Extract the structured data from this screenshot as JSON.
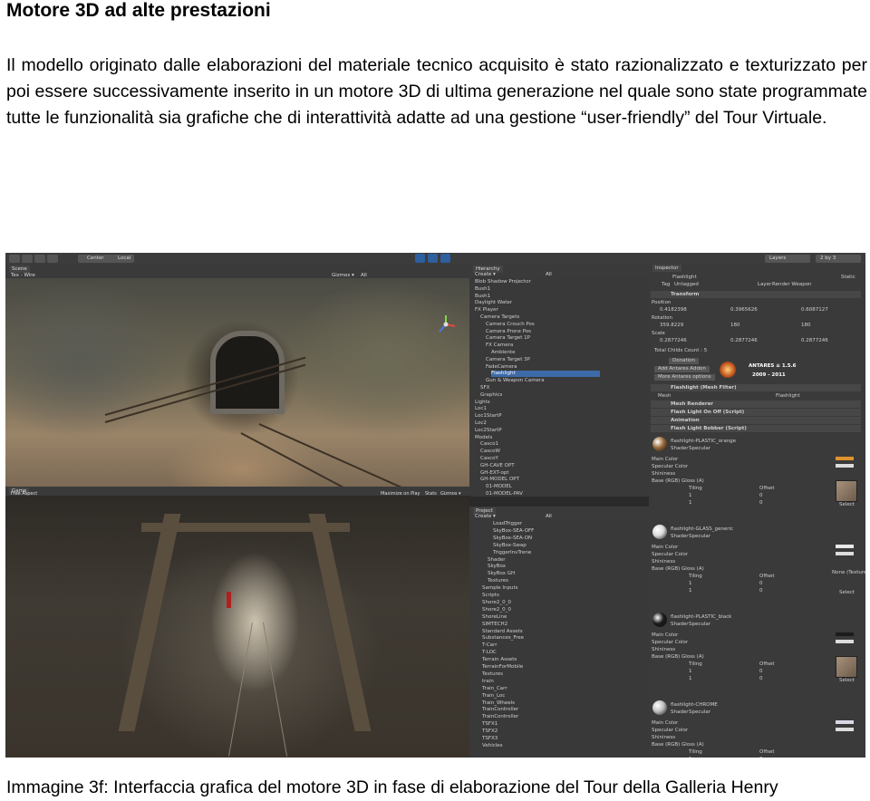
{
  "page": {
    "title": "Motore 3D ad alte prestazioni",
    "paragraph": "Il modello originato dalle elaborazioni del materiale tecnico acquisito è stato razionalizzato e texturizzato per poi essere successivamente inserito in un motore 3D di ultima generazione nel quale sono state programmate tutte le funzionalità sia grafiche che di interattività adatte ad una gestione “user-friendly” del Tour Virtuale.",
    "caption": "Immagine 3f: Interfaccia grafica del motore 3D in fase di elaborazione del Tour della Galleria Henry"
  },
  "editor": {
    "toolbar": {
      "center": "Center",
      "local": "Local",
      "layers": "Layers",
      "layout": "2 by 3"
    },
    "scene_tab": {
      "label": "Scene",
      "mode": "Tex - Wire",
      "gizmos": "Gizmos ▾",
      "all": "All"
    },
    "game_tab": {
      "label": "Game",
      "aspect": "Free Aspect",
      "maximize": "Maximize on Play",
      "stats": "Stats",
      "gizmos": "Gizmos ▾"
    },
    "hierarchy": {
      "label": "Hierarchy",
      "create": "Create ▾",
      "all": "All",
      "items": [
        "Blob Shadow Projector",
        "Bush1",
        "Bush1",
        "Daylight Water",
        "FX Player",
        "Camera Targets",
        "Camera Crouch Pos",
        "Camera Prone Pos",
        "Camera Target 1P",
        "FX Camera",
        "Ambiente",
        "Camera Target 3P",
        "FadeCamera",
        "Flashlight",
        "Gun & Weapon Camera",
        "SFX",
        "Graphics",
        "Lights",
        "Loc1",
        "Loc1StartP",
        "Loc2",
        "Loc2StartP",
        "Models",
        "Casco1",
        "CascoW",
        "CascoY",
        "GH-CAVE OPT",
        "GH-EXT-opt",
        "GH-MODEL OPT",
        "01-MODEL",
        "01-MODEL-PAV"
      ],
      "selected_index": 13
    },
    "project": {
      "label": "Project",
      "create": "Create ▾",
      "all": "All",
      "items": [
        "LoadTrigger",
        "SkyBox-SEA-OFF",
        "SkyBox-SEA-ON",
        "SkyBox-Swap",
        "TriggerInvTrene",
        "Shader",
        "SkyBox",
        "SkyBox GH",
        "Textures",
        "Sample Inputs",
        "Scripts",
        "Shore2_0_0",
        "Shore2_0_0",
        "ShoreLine",
        "SIMTECH2",
        "Standard Assets",
        "Substances_Free",
        "T-Carr",
        "T-LOC",
        "Terrain Assets",
        "TerrainForMobile",
        "Textures",
        "train",
        "Train_Carr",
        "Train_Loc",
        "Train_Wheels",
        "TrainController",
        "TrainController",
        "TSFX1",
        "TSFX2",
        "TSFX3",
        "Vehicles"
      ]
    },
    "inspector": {
      "label": "Inspector",
      "object_name": "Flashlight",
      "static": "Static",
      "tag_label": "Tag",
      "tag": "Untagged",
      "layer_label": "Layer",
      "layer": "Render Weapon",
      "transform": "Transform",
      "position_label": "Position",
      "position": {
        "x": "0.4182398",
        "y": "0.3965626",
        "z": "0.6087127"
      },
      "rotation_label": "Rotation",
      "rotation": {
        "x": "359.8229",
        "y": "180",
        "z": "180"
      },
      "scale_label": "Scale",
      "scale": {
        "x": "0.2877246",
        "y": "0.2877246",
        "z": "0.2877246"
      },
      "child_count": "Total Childs Count : 5",
      "donation": "Donation",
      "add_antares": "Add Antares Addon",
      "more_antares": "More Antares options",
      "antares_name": "ANTARES ≡ 1.5.6",
      "antares_years": "2009 - 2011",
      "mesh_filter": "Flashlight (Mesh Filter)",
      "mesh_label": "Mesh",
      "mesh_value": "Flashlight",
      "components": [
        "Mesh Renderer",
        "Flash Light On Off (Script)",
        "Animation",
        "Flash Light Bobber (Script)"
      ],
      "shader_label": "Shader",
      "main_color": "Main Color",
      "specular_color": "Specular Color",
      "shininess": "Shininess",
      "base_map": "Base (RGB) Gloss (A)",
      "tiling": "Tiling",
      "offset": "Offset",
      "select": "Select",
      "none_texture": "None (Texture)",
      "materials": [
        {
          "name": "flashlight-PLASTIC_orange",
          "shader": "Specular",
          "color": "#e0922c",
          "ball": "#9a6a3a"
        },
        {
          "name": "flashlight-GLASS_generic",
          "shader": "Specular",
          "color": "#e8e8e8",
          "ball": "#d9d9d9"
        },
        {
          "name": "flashlight-PLASTIC_black",
          "shader": "Specular",
          "color": "#1c1c1c",
          "ball": "#1b1b1b"
        },
        {
          "name": "flashlight-CHROME",
          "shader": "Specular",
          "color": "#d8d8e6",
          "ball": "#bfbfbf"
        }
      ],
      "tiling_values": {
        "x": "1",
        "y": "1"
      },
      "offset_values": {
        "x": "0",
        "y": "0"
      }
    }
  }
}
